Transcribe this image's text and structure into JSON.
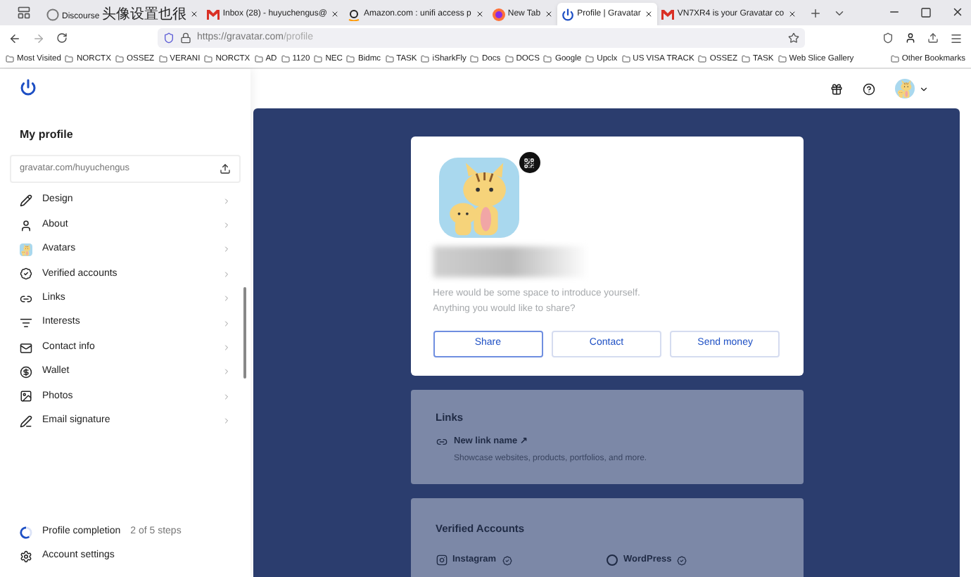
{
  "browser": {
    "tabs": [
      {
        "label": "Discourse 头像设置也很",
        "selected": false,
        "kind": "discourse"
      },
      {
        "label": "Inbox (28) - huyuchengus@",
        "selected": false,
        "kind": "mail"
      },
      {
        "label": "Amazon.com : unifi access p",
        "selected": false,
        "kind": "amazon"
      },
      {
        "label": "New Tab",
        "selected": false,
        "kind": "firefox"
      },
      {
        "label": "Profile | Gravatar",
        "selected": true,
        "kind": "gravatar"
      },
      {
        "label": "VN7XR4 is your Gravatar co",
        "selected": false,
        "kind": "mail"
      }
    ],
    "url_host": "https://gravatar.com",
    "url_path": "/profile",
    "bookmarks": [
      "Most Visited",
      "NORCTX",
      "OSSEZ",
      "VERANI",
      "NORCTX",
      "AD",
      "1120",
      "NEC",
      "Bidmc",
      "TASK",
      "iSharkFly",
      "Docs",
      "DOCS",
      "Google",
      "Upclx",
      "US VISA TRACK",
      "OSSEZ",
      "TASK",
      "Web Slice Gallery"
    ],
    "other_bookmarks": "Other Bookmarks"
  },
  "sidebar": {
    "title": "My profile",
    "profile_url": "gravatar.com/huyuchengus",
    "items": [
      {
        "label": "Design"
      },
      {
        "label": "About"
      },
      {
        "label": "Avatars"
      },
      {
        "label": "Verified accounts"
      },
      {
        "label": "Links"
      },
      {
        "label": "Interests"
      },
      {
        "label": "Contact info"
      },
      {
        "label": "Wallet"
      },
      {
        "label": "Photos"
      },
      {
        "label": "Email signature"
      }
    ],
    "completion": {
      "label": "Profile completion",
      "steps": "2 of 5 steps"
    },
    "account_settings": "Account settings"
  },
  "profile_card": {
    "bio_placeholder": "Here would be some space to introduce yourself.\nAnything you would like to share?",
    "buttons": [
      {
        "label": "Share",
        "selected": true
      },
      {
        "label": "Contact",
        "selected": false
      },
      {
        "label": "Send money",
        "selected": false
      }
    ]
  },
  "links_section": {
    "title": "Links",
    "link_name": "New link name ↗",
    "hint": "Showcase websites, products, portfolios, and more."
  },
  "verified_section": {
    "title": "Verified Accounts",
    "accounts": [
      "Instagram",
      "WordPress"
    ]
  }
}
